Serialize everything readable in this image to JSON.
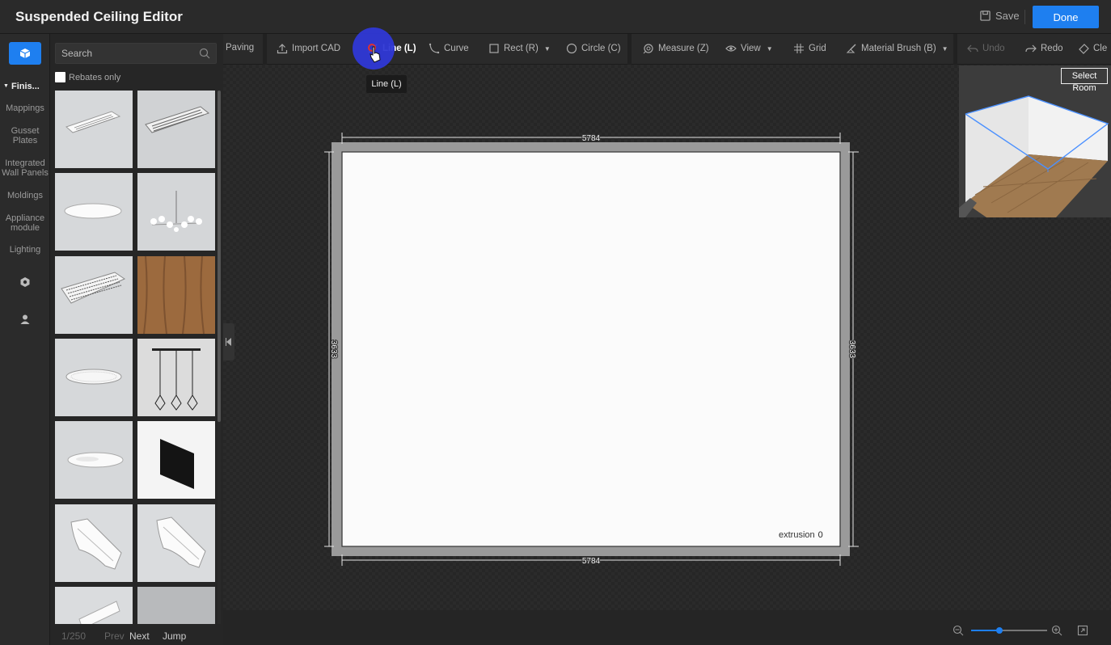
{
  "app": {
    "title": "Suspended Ceiling Editor",
    "save_label": "Save",
    "done_label": "Done"
  },
  "rail": {
    "categories": [
      {
        "label": "Finis...",
        "active": true
      },
      {
        "label": "Mappings"
      },
      {
        "label": "Gusset Plates"
      },
      {
        "label": "Integrated Wall Panels"
      },
      {
        "label": "Moldings"
      },
      {
        "label": "Appliance module"
      },
      {
        "label": "Lighting"
      }
    ]
  },
  "catalog": {
    "search_placeholder": "Search",
    "rebates_label": "Rebates only",
    "pager": {
      "page": "1/250",
      "prev": "Prev",
      "next": "Next",
      "jump": "Jump"
    }
  },
  "toolbar": {
    "paving": "Paving",
    "import_cad": "Import CAD",
    "line": "Line (L)",
    "curve": "Curve",
    "rect": "Rect (R)",
    "circle": "Circle (C)",
    "measure": "Measure (Z)",
    "view": "View",
    "grid": "Grid",
    "material_brush": "Material Brush (B)",
    "undo": "Undo",
    "redo": "Redo",
    "clear": "Cle"
  },
  "tooltip": {
    "text": "Line (L)"
  },
  "room": {
    "dim_top": "5784",
    "dim_bottom": "5784",
    "dim_left": "3633",
    "dim_right": "3633",
    "extrusion_label": "extrusion",
    "extrusion_value": "0"
  },
  "preview": {
    "select_room_line1": "Select",
    "select_room_line2": "Room"
  },
  "colors": {
    "accent": "#1e7ff0",
    "background": "#232323",
    "panel": "#2a2a2a"
  }
}
